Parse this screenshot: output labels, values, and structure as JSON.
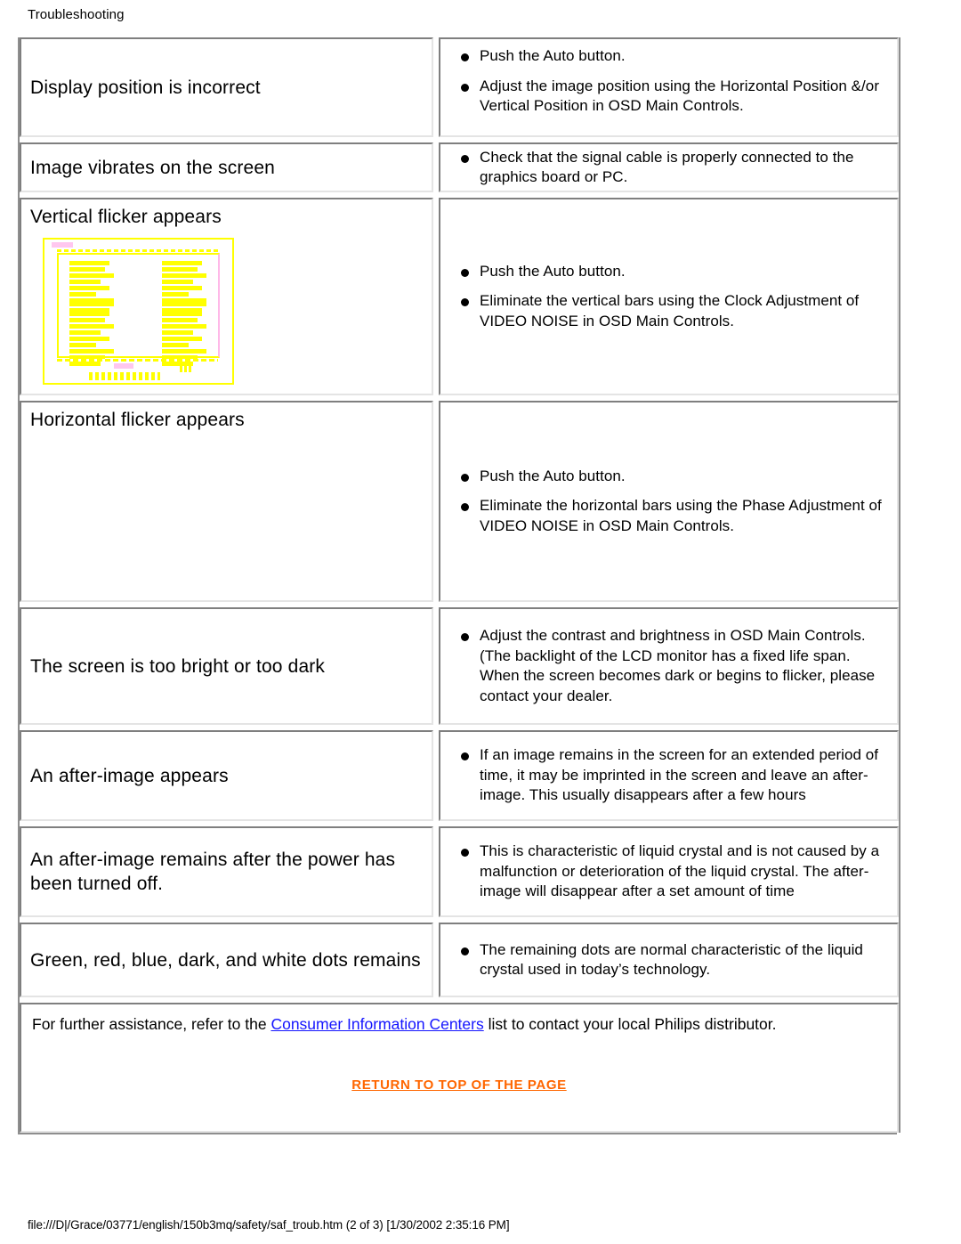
{
  "page": {
    "header": "Troubleshooting",
    "status_footer": "file:///D|/Grace/03771/english/150b3mq/safety/saf_troub.htm (2 of 3) [1/30/2002 2:35:16 PM]"
  },
  "colors": {
    "link": "#1414ff",
    "return_top_link": "#ff6600",
    "thumbnail_highlight": "#ffff00",
    "thumbnail_accent": "#ffc7ef",
    "cell_border_dark": "#7f7f7f",
    "cell_border_light": "#e4e4e4"
  },
  "table": {
    "rows": [
      {
        "symptom": "Display position is incorrect",
        "symptom_align": "center",
        "fixes": [
          "Push the Auto button.",
          "Adjust the image position using the Horizontal Position &/or Vertical Position in OSD Main Controls."
        ],
        "fix_align": "top",
        "has_thumbnail": false,
        "symptom_cell_height": 112,
        "fix_cell_height": 112
      },
      {
        "symptom": "Image vibrates on the screen",
        "symptom_align": "center",
        "fixes": [
          "Check that the signal cable is properly connected to the graphics board or PC."
        ],
        "fix_align": "center",
        "has_thumbnail": false,
        "symptom_cell_height": 56,
        "fix_cell_height": 56
      },
      {
        "symptom": "Vertical flicker appears",
        "symptom_align": "top",
        "fixes": [
          "Push the Auto button.",
          "Eliminate the vertical bars using the Clock Adjustment of VIDEO NOISE in OSD Main Controls."
        ],
        "fix_align": "center",
        "has_thumbnail": true,
        "symptom_cell_height": 222,
        "fix_cell_height": 222
      },
      {
        "symptom": "Horizontal flicker appears",
        "symptom_align": "top",
        "fixes": [
          "Push the Auto button.",
          "Eliminate the horizontal bars using the Phase Adjustment of VIDEO NOISE in OSD Main Controls."
        ],
        "fix_align": "center",
        "has_thumbnail": false,
        "symptom_cell_height": 226,
        "fix_cell_height": 226
      },
      {
        "symptom": "The screen is too bright or too dark",
        "symptom_align": "center",
        "fixes": [
          "Adjust the contrast and brightness in OSD Main Controls. (The backlight of the LCD monitor has a fixed life span. When the screen becomes dark or begins to flicker, please contact your dealer."
        ],
        "fix_align": "center",
        "has_thumbnail": false,
        "symptom_cell_height": 132,
        "fix_cell_height": 132
      },
      {
        "symptom": "An after-image appears",
        "symptom_align": "center",
        "fixes": [
          "If an image remains in the screen for an extended period of time, it may be imprinted in the screen and leave an after-image. This usually disappears after a few hours"
        ],
        "fix_align": "center",
        "has_thumbnail": false,
        "symptom_cell_height": 102,
        "fix_cell_height": 102
      },
      {
        "symptom": "An after-image remains after the power has been turned off.",
        "symptom_align": "center",
        "fixes": [
          "This is characteristic of liquid crystal and is not caused by a malfunction or deterioration of the liquid crystal. The after-image will disappear after a set amount of time"
        ],
        "fix_align": "center",
        "has_thumbnail": false,
        "symptom_cell_height": 102,
        "fix_cell_height": 102
      },
      {
        "symptom": "Green, red, blue, dark, and white dots remains",
        "symptom_align": "center",
        "fixes": [
          "The remaining dots are normal characteristic of the liquid crystal used in today’s technology."
        ],
        "fix_align": "center",
        "has_thumbnail": false,
        "symptom_cell_height": 84,
        "fix_cell_height": 84
      }
    ]
  },
  "note": {
    "text_before_link": "For further assistance, refer to the ",
    "link_label": "Consumer Information Centers",
    "text_after_link": " list to contact your local Philips distributor.",
    "return_to_top": "RETURN TO TOP OF THE PAGE"
  }
}
